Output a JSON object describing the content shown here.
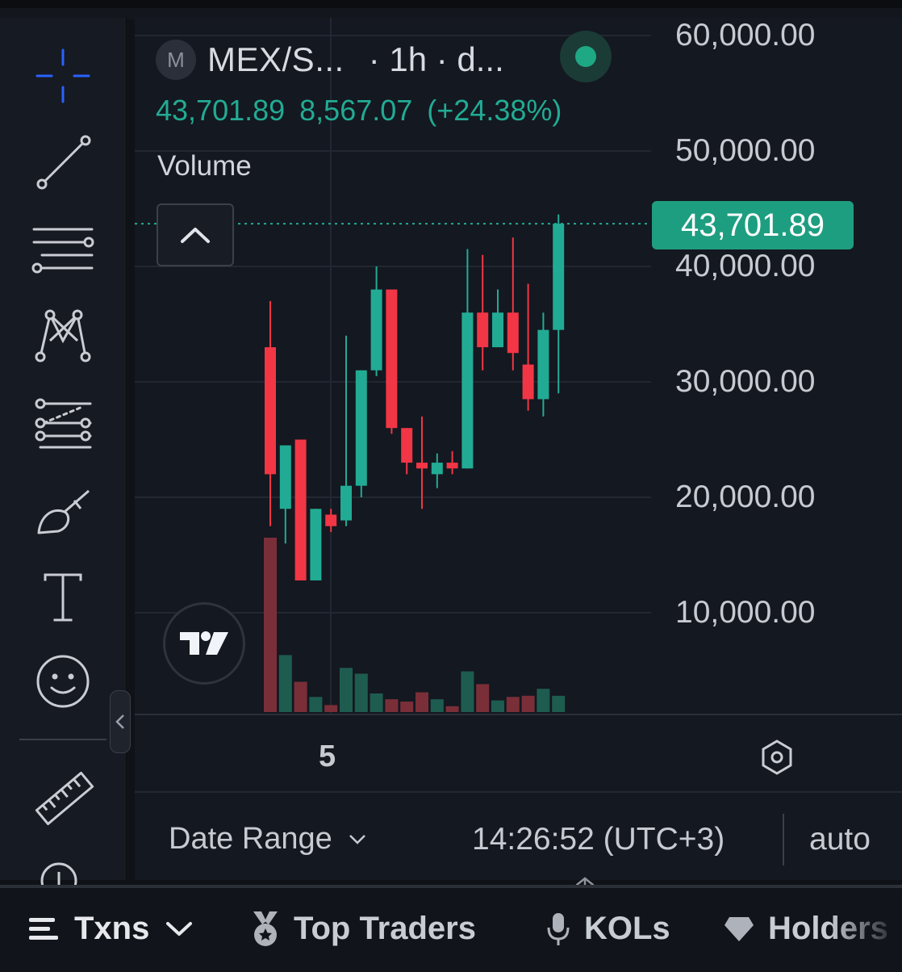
{
  "chart_header": {
    "symbol_badge": "M",
    "symbol": "MEX/S...",
    "interval": "· 1h · d...",
    "last_price": "43,701.89",
    "change": "8,567.07",
    "change_pct": "(+24.38%)",
    "volume_label": "Volume"
  },
  "price_tag": "43,701.89",
  "price_axis": {
    "labels": [
      "60,000.00",
      "50,000.00",
      "40,000.00",
      "30,000.00",
      "20,000.00",
      "10,000.00"
    ]
  },
  "time_axis": {
    "tick": "5"
  },
  "footer": {
    "date_range": "Date Range",
    "clock": "14:26:52 (UTC+3)",
    "scale_mode": "auto"
  },
  "tabs": {
    "txns": "Txns",
    "top_traders": "Top Traders",
    "kols": "KOLs",
    "holders": "Holders"
  },
  "colors": {
    "up": "#22ab94",
    "down": "#f23645",
    "accent": "#2962ff"
  },
  "icons": [
    "crosshair-icon",
    "trend-line-icon",
    "horizontal-lines-icon",
    "pattern-icon",
    "fib-icon",
    "brush-icon",
    "text-icon",
    "emoji-icon",
    "ruler-icon",
    "zoom-icon"
  ],
  "chart_data": {
    "type": "candlestick",
    "ylim": [
      0,
      60000
    ],
    "last": 43701.89,
    "candles": [
      {
        "o": 33000,
        "h": 37000,
        "l": 17500,
        "c": 22000
      },
      {
        "o": 19000,
        "h": 22000,
        "l": 16000,
        "c": 24500
      },
      {
        "o": 25000,
        "h": 25000,
        "l": 12800,
        "c": 12800
      },
      {
        "o": 12800,
        "h": 19000,
        "l": 12800,
        "c": 19000
      },
      {
        "o": 18500,
        "h": 19000,
        "l": 17000,
        "c": 17500
      },
      {
        "o": 18000,
        "h": 34000,
        "l": 17500,
        "c": 21000
      },
      {
        "o": 21000,
        "h": 31000,
        "l": 20000,
        "c": 31000
      },
      {
        "o": 31000,
        "h": 40000,
        "l": 30500,
        "c": 38000
      },
      {
        "o": 38000,
        "h": 38000,
        "l": 25500,
        "c": 26000
      },
      {
        "o": 26000,
        "h": 26000,
        "l": 22000,
        "c": 23000
      },
      {
        "o": 23000,
        "h": 27000,
        "l": 19000,
        "c": 22500
      },
      {
        "o": 22000,
        "h": 23800,
        "l": 20800,
        "c": 23000
      },
      {
        "o": 23000,
        "h": 24000,
        "l": 22000,
        "c": 22500
      },
      {
        "o": 22500,
        "h": 41500,
        "l": 22500,
        "c": 36000
      },
      {
        "o": 36000,
        "h": 41000,
        "l": 31000,
        "c": 33000
      },
      {
        "o": 33000,
        "h": 38000,
        "l": 33000,
        "c": 36000
      },
      {
        "o": 36000,
        "h": 42500,
        "l": 31000,
        "c": 32500
      },
      {
        "o": 31500,
        "h": 38500,
        "l": 27500,
        "c": 28500
      },
      {
        "o": 28500,
        "h": 36000,
        "l": 27000,
        "c": 34500
      },
      {
        "o": 34500,
        "h": 44500,
        "l": 29000,
        "c": 43701.89
      }
    ],
    "volume": [
      15,
      4.9,
      2.6,
      1.3,
      0.6,
      3.8,
      3.3,
      1.6,
      1.1,
      0.9,
      1.7,
      1.1,
      0.5,
      3.5,
      2.4,
      1.0,
      1.3,
      1.4,
      2.0,
      1.4
    ]
  }
}
